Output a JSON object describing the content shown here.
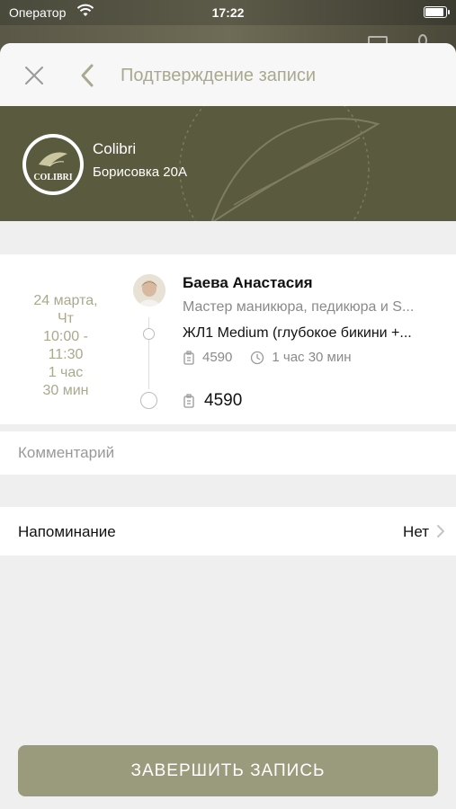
{
  "status_bar": {
    "carrier": "Оператор",
    "time": "17:22",
    "battery_level": 0.9
  },
  "navbar": {
    "title": "Подтверждение записи",
    "close_icon": "close-icon",
    "back_icon": "chevron-left-icon"
  },
  "salon": {
    "name": "Colibri",
    "address": "Борисовка 20А",
    "logo_text": "COLIBRI"
  },
  "appointment": {
    "date_line1": "24 марта,",
    "date_line2": "Чт",
    "time_line1": "10:00 -",
    "time_line2": "11:30",
    "duration_line1": "1 час",
    "duration_line2": "30 мин",
    "master_name": "Баева Анастасия",
    "master_role": "Мастер маникюра, педикюра и S...",
    "service_name": "ЖЛ1 Medium (глубокое бикини +...",
    "service_price": "4590",
    "service_duration": "1 час 30 мин",
    "total_price": "4590"
  },
  "comment": {
    "placeholder": "Комментарий"
  },
  "reminder": {
    "label": "Напоминание",
    "value": "Нет"
  },
  "finish_button": {
    "label": "ЗАВЕРШИТЬ ЗАПИСЬ"
  },
  "colors": {
    "accent": "#a9a98f",
    "brand_dark": "#5a5a3e",
    "button": "#9a9a7c"
  }
}
